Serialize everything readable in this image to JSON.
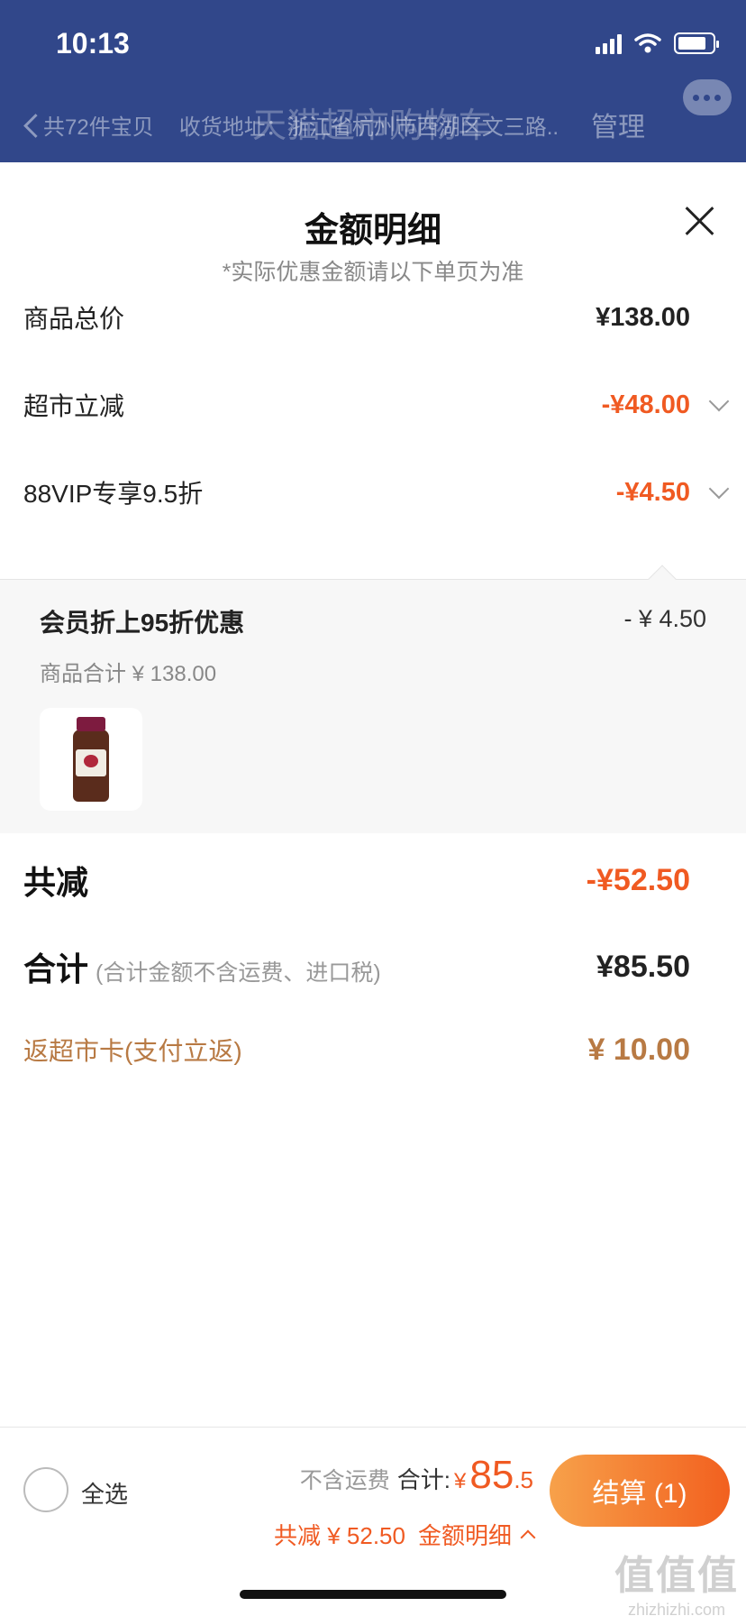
{
  "status_bar": {
    "time": "10:13"
  },
  "background_header": {
    "title": "天猫超市购物车",
    "count_text": "共72件宝贝",
    "address_text": "收货地址：浙江省杭州市西湖区文三路...单元...",
    "manage_label": "管理"
  },
  "panel": {
    "title": "金额明细",
    "note": "*实际优惠金额请以下单页为准",
    "rows": [
      {
        "label": "商品总价",
        "value": "¥138.00"
      },
      {
        "label": "超市立减",
        "value": "-¥48.00"
      },
      {
        "label": "88VIP专享9.5折",
        "value": "-¥4.50"
      }
    ],
    "detail": {
      "title": "会员折上95折优惠",
      "value": "- ¥ 4.50",
      "subtotal": "商品合计 ¥ 138.00"
    },
    "total_discount": {
      "label": "共减",
      "value": "-¥52.50"
    },
    "total": {
      "label": "合计",
      "hint": "(合计金额不含运费、进口税)",
      "value": "¥85.50"
    },
    "rebate": {
      "label": "返超市卡(支付立返)",
      "value": "¥ 10.00"
    }
  },
  "bottom_bar": {
    "select_all_label": "全选",
    "excl_shipping": "不含运费",
    "sum_label": "合计:",
    "currency": "¥",
    "amount_int": "85",
    "amount_dec": ".5",
    "discount_text": "共减 ¥ 52.50",
    "detail_link": "金额明细",
    "checkout_label": "结算 (1)"
  },
  "watermark": {
    "main": "值值值",
    "sub": "zhizhizhi.com"
  },
  "colors": {
    "header_bg": "#31478a",
    "accent_orange": "#f05a22",
    "rebate_brown": "#b87a44",
    "checkout_gradient_start": "#f7a14a",
    "checkout_gradient_end": "#f2601f"
  }
}
